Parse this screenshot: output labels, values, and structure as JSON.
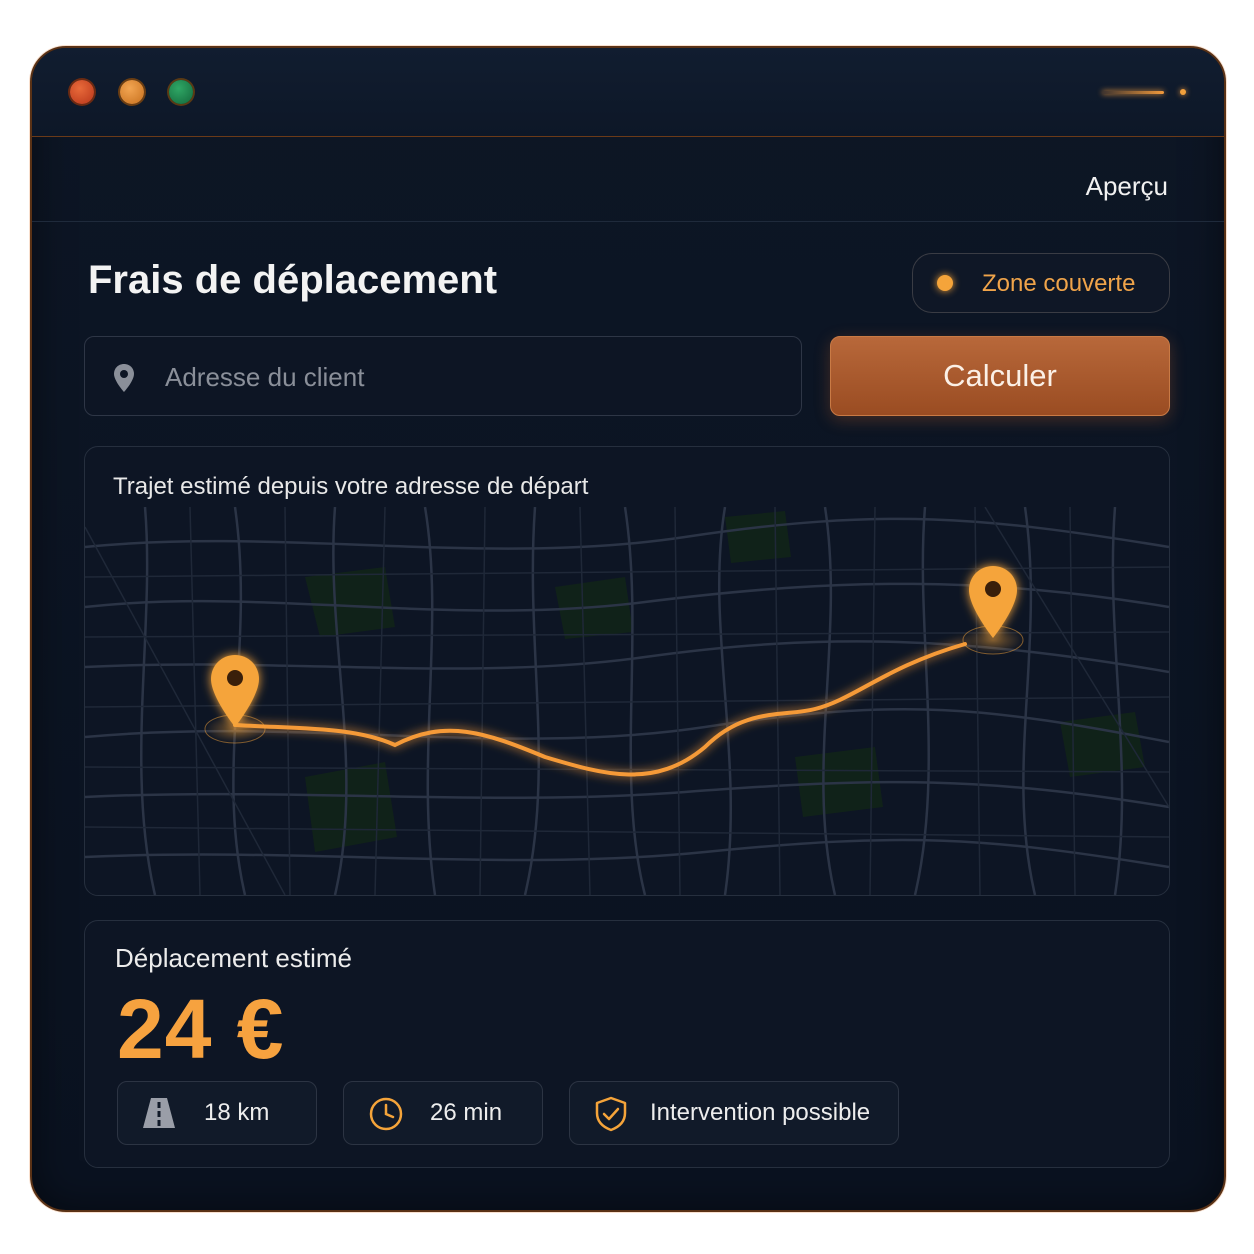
{
  "window": {
    "controls": [
      "close",
      "minimize",
      "maximize"
    ],
    "accent": "#f29a3c"
  },
  "header": {
    "apercu_label": "Aperçu"
  },
  "page": {
    "title": "Frais de déplacement",
    "zone_badge": "Zone couverte"
  },
  "search": {
    "placeholder": "Adresse du client",
    "value": "",
    "icon": "map-pin-icon",
    "button_label": "Calculer"
  },
  "map": {
    "caption": "Trajet estimé depuis votre adresse de départ",
    "markers": [
      "start-pin-icon",
      "destination-pin-icon"
    ]
  },
  "result": {
    "label": "Déplacement estimé",
    "price": "24 €",
    "chips": [
      {
        "icon": "road-icon",
        "label": "18 km"
      },
      {
        "icon": "clock-icon",
        "label": "26 min"
      },
      {
        "icon": "shield-check-icon",
        "label": "Intervention possible"
      }
    ]
  },
  "colors": {
    "background": "#0b1322",
    "accent_orange": "#f5a43a",
    "button": "#a85a2c",
    "text": "#f0f0f0"
  }
}
